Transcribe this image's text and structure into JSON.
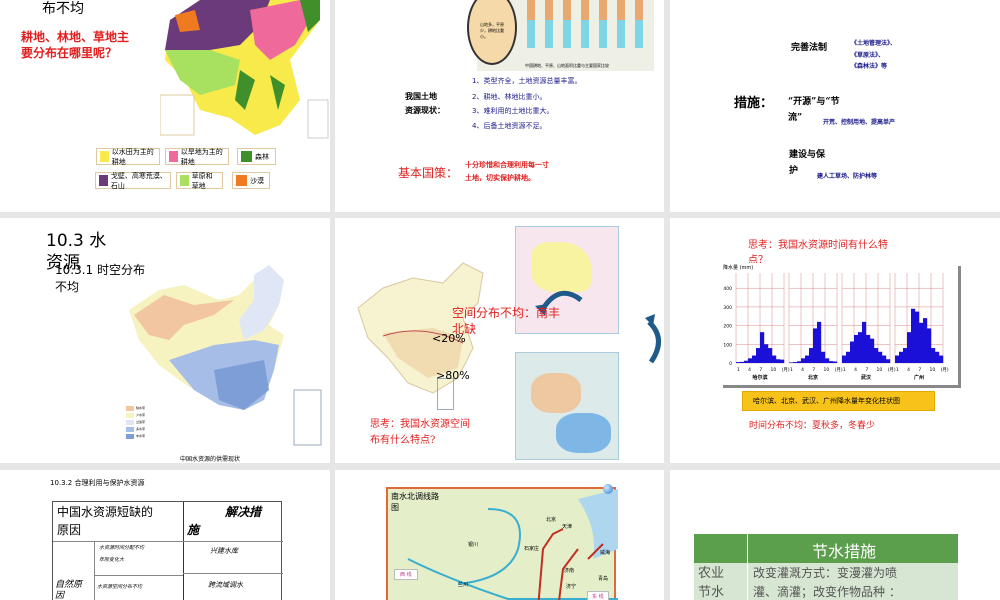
{
  "slides": [
    {
      "heading_tail": "布不均",
      "question": "耕地、林地、草地主\n要分布在哪里呢？",
      "legend": [
        {
          "label": "以水田为主的耕地",
          "color": "#f7ea4a"
        },
        {
          "label": "以旱地为主的耕地",
          "color": "#ef6a9a"
        },
        {
          "label": "森林",
          "color": "#3f8f2a"
        },
        {
          "label": "戈壁、高寒荒漠、石山",
          "color": "#6a3a7a"
        },
        {
          "label": "草原和草地",
          "color": "#a8e060"
        },
        {
          "label": "沙漠",
          "color": "#f07a20"
        }
      ]
    },
    {
      "chart_note": "山地多，平原少，耕地比重小。",
      "chart_caption": "中国耕地、平原、山地面积比重与主要国家比较",
      "status_label": "我国土地\n资源现状：",
      "items": [
        "1、类型齐全，土地资源总量丰富。",
        "2、耕地、林地比重小。",
        "3、难利用的土地比重大。",
        "4、后备土地资源不足。"
      ],
      "policy_label": "基本国策：",
      "policy_text": "十分珍惜和合理利用每一寸\n土地，切实保护耕地。"
    },
    {
      "law_label": "完善法制",
      "laws": [
        "《土地管理法》、",
        "《草原法》、",
        "《森林法》等"
      ],
      "measures_label": "措施：",
      "open_label": "“开源”与“节\n流”",
      "open_text": "开荒、控制用地、提高单产",
      "build_label": "建设与保\n护",
      "build_text": "建人工草场、防护林等"
    },
    {
      "title": "10.3 水\n资源",
      "subtitle": "10.3.1 时空分布\n不均",
      "map_caption": "中国水资源的供需现状",
      "legend": [
        "缺水带",
        "少水带",
        "过渡带",
        "多水带",
        "丰水带"
      ]
    },
    {
      "spatial": "空间分布不均：南丰\n北缺",
      "lt20": "<20%",
      "gt80": ">80%",
      "question": "思考：我国水资源空间\n布有什么特点?"
    },
    {
      "question": "思考：我国水资源时间有什么特\n点？",
      "ylabel": "降水量 (mm)",
      "yticks": [
        "0",
        "100",
        "200",
        "300",
        "400"
      ],
      "xticks": [
        "1",
        "4",
        "7",
        "10",
        "(月)"
      ],
      "caption": "哈尔滨、北京、武汉、广州降水量年变化柱状图",
      "answer": "时间分布不均：夏秋多，冬春少",
      "chart_data": {
        "type": "bar",
        "ylabel": "降水量 (mm)",
        "ylim": [
          0,
          460
        ],
        "categories": [
          "1",
          "2",
          "3",
          "4",
          "5",
          "6",
          "7",
          "8",
          "9",
          "10",
          "11",
          "12"
        ],
        "series": [
          {
            "name": "哈尔滨",
            "values": [
              5,
              6,
              12,
              25,
              40,
              80,
              165,
              100,
              80,
              40,
              20,
              18
            ]
          },
          {
            "name": "北京",
            "values": [
              3,
              5,
              9,
              25,
              40,
              80,
              185,
              220,
              60,
              25,
              10,
              8
            ]
          },
          {
            "name": "武汉",
            "values": [
              40,
              60,
              115,
              150,
              165,
              220,
              150,
              130,
              80,
              60,
              40,
              20
            ]
          },
          {
            "name": "广州",
            "values": [
              40,
              60,
              80,
              165,
              290,
              275,
              215,
              240,
              185,
              80,
              60,
              40
            ]
          }
        ]
      }
    },
    {
      "heading": "10.3.2 合理利用与保护水资源",
      "col1": "中国水资源短缺的\n原因",
      "col2": "解决措\n施",
      "natural": "自然原\n因",
      "reason1": "水资源时间分配不均\n年际变化大",
      "reason2": "水资源空间分布不均",
      "fix1": "兴建水库",
      "fix2": "跨流域调水"
    },
    {
      "map_title": "南水北调线路\n图",
      "west": "西 线",
      "east": "东 线",
      "cities": [
        "北京",
        "天津",
        "石家庄",
        "银川",
        "兰州",
        "济南",
        "济宁",
        "青岛",
        "威海"
      ]
    },
    {
      "header": "节水措施",
      "row_label": "农业\n节水",
      "row_text": "改变灌溉方式：变漫灌为喷\n灌、滴灌；改变作物品种 ："
    }
  ]
}
